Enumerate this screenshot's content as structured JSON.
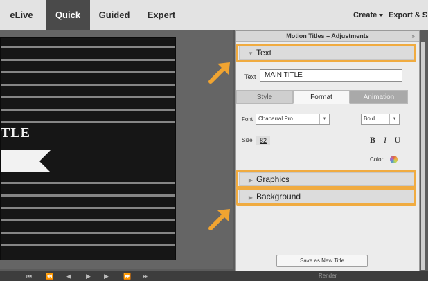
{
  "top_bar": {
    "modes": [
      {
        "label": "eLive",
        "active": false
      },
      {
        "label": "Quick",
        "active": true
      },
      {
        "label": "Guided",
        "active": false
      },
      {
        "label": "Expert",
        "active": false
      }
    ],
    "create_label": "Create",
    "export_label": "Export & Sh"
  },
  "video": {
    "overlay_title_fragment": "TLE"
  },
  "panel": {
    "title": "Motion Titles – Adjustments",
    "close_glyph": "»",
    "sections": {
      "text": "Text",
      "graphics": "Graphics",
      "background": "Background"
    },
    "text_field": {
      "label": "Text",
      "value": "MAIN TITLE"
    },
    "tabs": [
      "Style",
      "Format",
      "Animation"
    ],
    "active_tab": "Format",
    "font": {
      "label": "Font",
      "value": "Chaparral Pro",
      "weight_value": "Bold"
    },
    "size": {
      "label": "Size",
      "value": "82"
    },
    "style_buttons": {
      "bold": "B",
      "italic": "I",
      "underline": "U"
    },
    "color_label": "Color:",
    "save_button": "Save as New Title"
  },
  "bottom_bar": {
    "render_label": "Render"
  },
  "colors": {
    "highlight": "#f0ab40",
    "arrow": "#f0a431",
    "active_mode_bg": "#4a4a4a"
  },
  "icons": [
    "caret-down-icon",
    "expand-triangle-icon",
    "collapse-triangle-icon",
    "color-wheel-icon",
    "play-icon",
    "arrow-pointer-icon"
  ]
}
